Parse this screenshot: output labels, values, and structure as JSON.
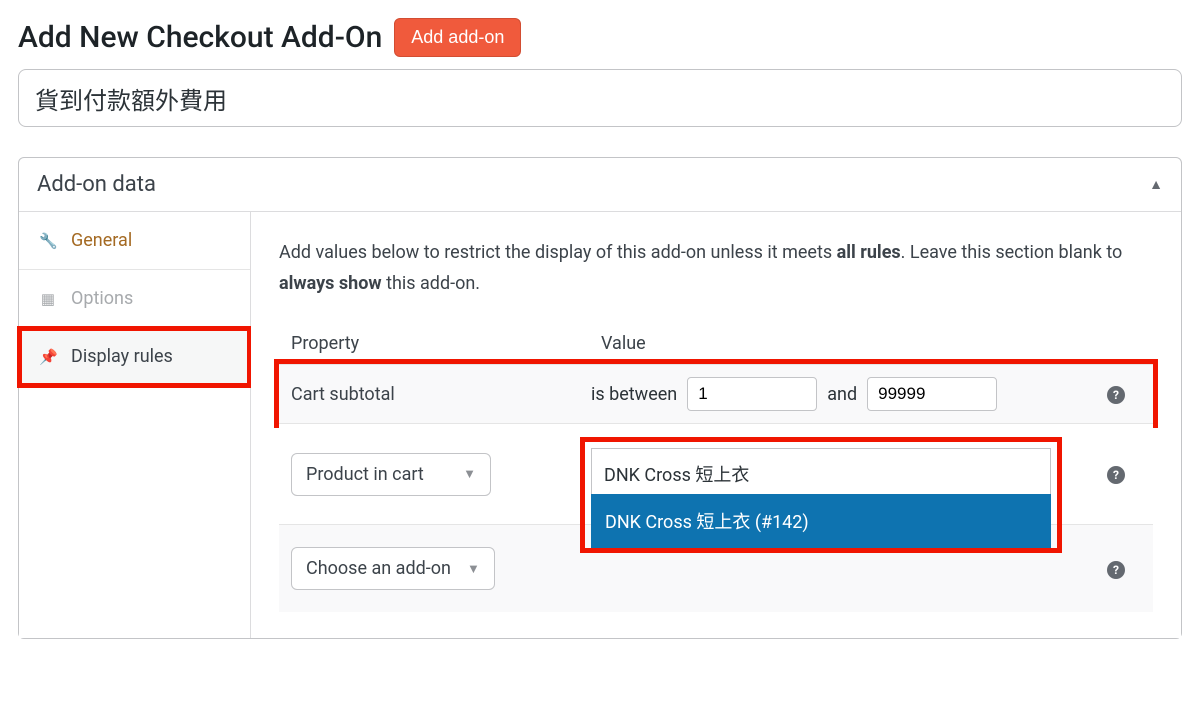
{
  "header": {
    "title": "Add New Checkout Add-On",
    "add_button": "Add add-on"
  },
  "title_field": {
    "value": "貨到付款額外費用",
    "placeholder": ""
  },
  "panel": {
    "title": "Add-on data"
  },
  "tabs": {
    "general": "General",
    "options": "Options",
    "display_rules": "Display rules"
  },
  "intro": {
    "pre": "Add values below to restrict the display of this add-on unless it meets ",
    "bold1": "all rules",
    "mid": ". Leave this section blank to ",
    "bold2": "always show",
    "post": " this add-on."
  },
  "columns": {
    "property": "Property",
    "value": "Value"
  },
  "rules": {
    "cart_subtotal": {
      "label": "Cart subtotal",
      "operator": "is between",
      "from": "1",
      "conj": "and",
      "to": "99999"
    },
    "product_in_cart": {
      "label": "Product in cart",
      "search_value": "DNK Cross 短上衣",
      "option": "DNK Cross 短上衣 (#142)"
    },
    "choose_addon": {
      "label": "Choose an add-on"
    }
  },
  "help_glyph": "?"
}
